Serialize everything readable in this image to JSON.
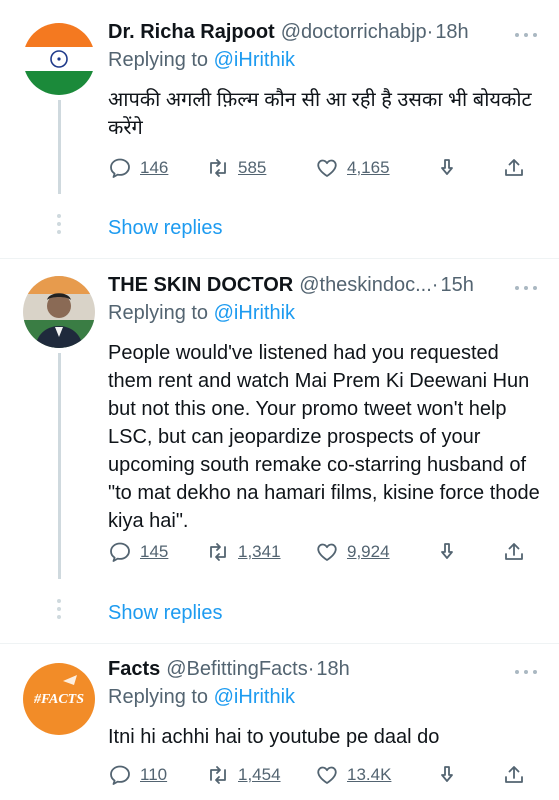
{
  "tweets": [
    {
      "name": "Dr. Richa Rajpoot",
      "handle": "@doctorrichabjp",
      "dot": "·",
      "time": "18h",
      "replying_prefix": "Replying to ",
      "replying_to": "@iHrithik",
      "text": "आपकी अगली फ़िल्म कौन सी आ रही है उसका भी बोयकोट करेंगे",
      "replies": "146",
      "retweets": "585",
      "likes": "4,165",
      "show_replies": "Show replies"
    },
    {
      "name": "THE SKIN DOCTOR",
      "handle": "@theskindoc...",
      "dot": "·",
      "time": "15h",
      "replying_prefix": "Replying to ",
      "replying_to": "@iHrithik",
      "text": "People would've listened had you requested them rent and watch Mai Prem Ki Deewani Hun but not this one. Your promo tweet won't help LSC, but can jeopardize prospects of your upcoming south remake co-starring husband of \"to mat dekho na hamari films, kisine force thode kiya hai\".",
      "replies": "145",
      "retweets": "1,341",
      "likes": "9,924",
      "show_replies": "Show replies"
    },
    {
      "name": "Facts",
      "handle": "@BefittingFacts",
      "dot": "·",
      "time": "18h",
      "replying_prefix": "Replying to ",
      "replying_to": "@iHrithik",
      "text": "Itni hi achhi hai to youtube pe daal do",
      "replies": "110",
      "retweets": "1,454",
      "likes": "13.4K",
      "avatar_text": "#FACTS"
    }
  ],
  "icons": [
    "reply-icon",
    "retweet-icon",
    "like-icon",
    "share-icon",
    "upload-icon",
    "more-icon"
  ],
  "colors": {
    "accent": "#1d9bf0",
    "muted": "#536471",
    "divider": "#eff3f4",
    "text": "#0f1419"
  }
}
